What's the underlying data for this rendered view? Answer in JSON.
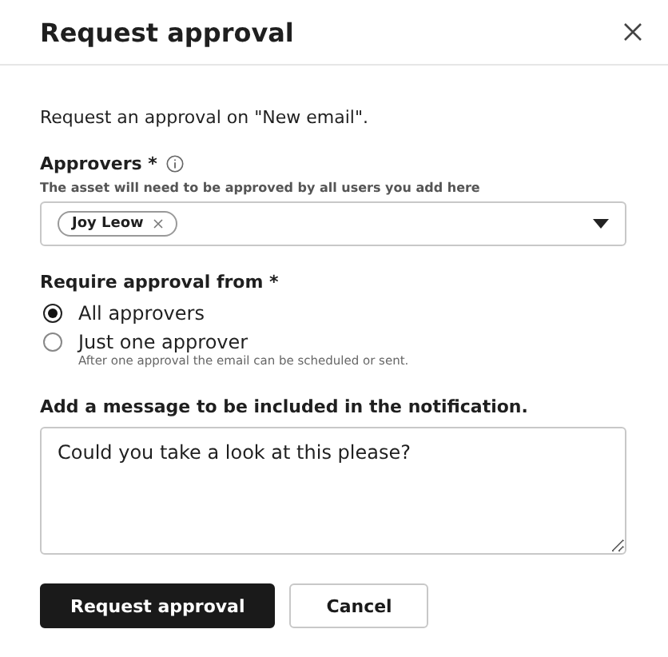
{
  "window": {
    "title": "Request approval"
  },
  "intro": "Request an approval on \"New email\".",
  "approvers": {
    "label": "Approvers *",
    "hint": "The asset will need to be approved by all users you add here",
    "chips": [
      {
        "label": "Joy Leow"
      }
    ]
  },
  "require": {
    "label": "Require approval from *",
    "options": [
      {
        "label": "All approvers",
        "selected": true
      },
      {
        "label": "Just one approver",
        "selected": false,
        "hint": "After one approval the email can be scheduled or sent."
      }
    ]
  },
  "message": {
    "label": "Add a message to be included in the notification.",
    "value": "Could you take a look at this please?"
  },
  "buttons": [
    {
      "label": "Request approval",
      "kind": "primary"
    },
    {
      "label": "Cancel",
      "kind": "secondary"
    }
  ]
}
